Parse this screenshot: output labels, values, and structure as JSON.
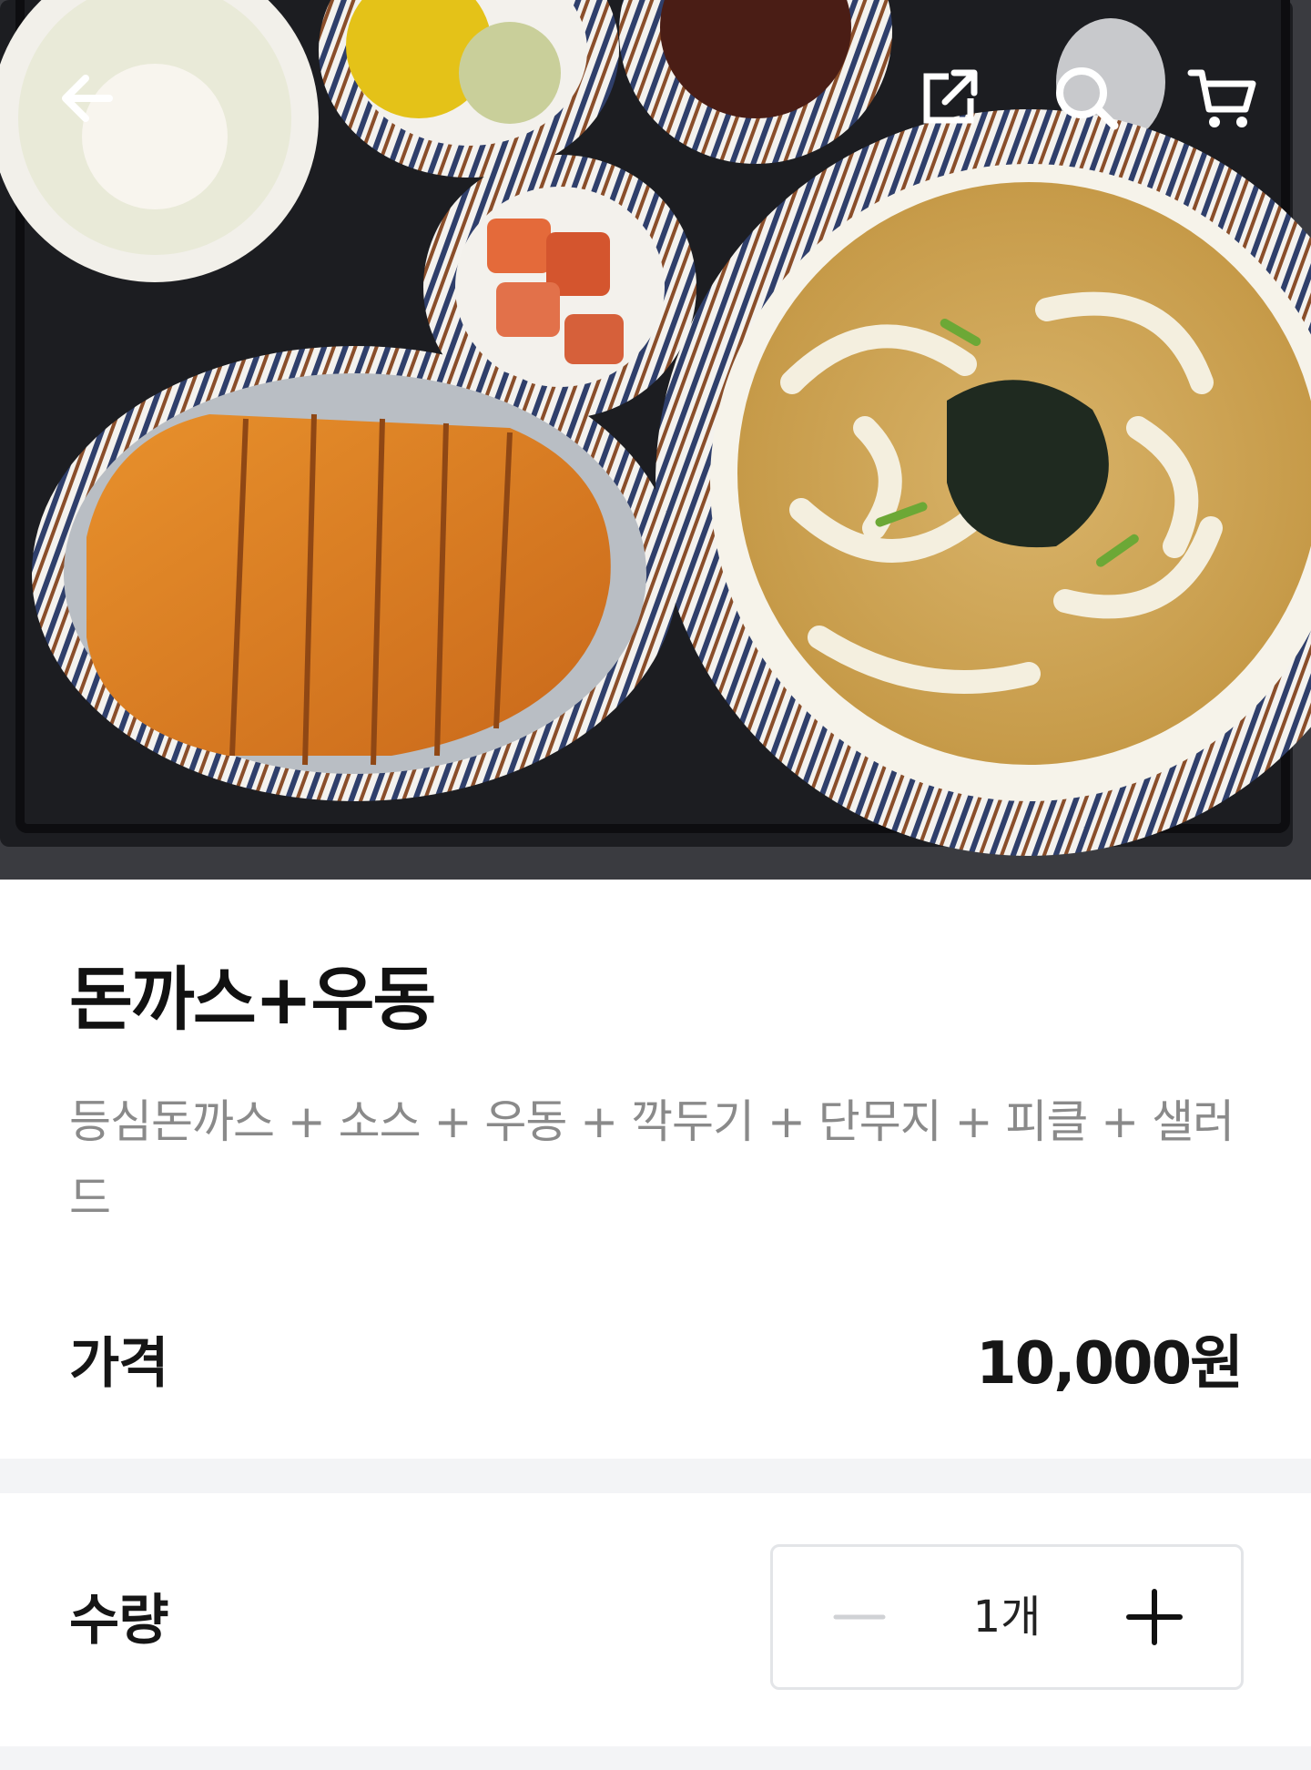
{
  "header": {
    "back_icon": "back-arrow-icon",
    "share_icon": "share-external-icon",
    "search_icon": "search-icon",
    "cart_icon": "shopping-cart-icon"
  },
  "hero": {
    "subject": "tonkatsu-and-udon-set-photo"
  },
  "product": {
    "title": "돈까스+우동",
    "description": "등심돈까스 + 소스 + 우동 + 깍두기 + 단무지 + 피클 + 샐러드"
  },
  "price": {
    "label": "가격",
    "value": "10,000원"
  },
  "quantity": {
    "label": "수량",
    "value": "1개",
    "minus_enabled": false
  },
  "colors": {
    "text_primary": "#161616",
    "text_secondary": "#8a8a8a",
    "divider": "#f3f4f6",
    "stepper_border": "#e3e5e8",
    "minus_disabled": "#d0d2d5"
  }
}
